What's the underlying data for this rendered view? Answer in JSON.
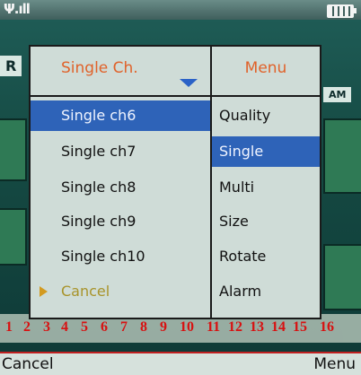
{
  "status": {
    "signal_icon": "signal-strength-icon",
    "battery_icon": "battery-icon"
  },
  "dialog": {
    "left_header": "Single Ch.",
    "right_header": "Menu",
    "channels": [
      {
        "label": "Single ch6",
        "selected": true
      },
      {
        "label": "Single ch7",
        "selected": false
      },
      {
        "label": "Single ch8",
        "selected": false
      },
      {
        "label": "Single ch9",
        "selected": false
      },
      {
        "label": "Single ch10",
        "selected": false
      },
      {
        "label": "Cancel",
        "selected": false
      }
    ],
    "menu": [
      {
        "label": "Quality",
        "selected": false
      },
      {
        "label": "Single",
        "selected": true
      },
      {
        "label": "Multi",
        "selected": false
      },
      {
        "label": "Size",
        "selected": false
      },
      {
        "label": "Rotate",
        "selected": false
      },
      {
        "label": "Alarm",
        "selected": false
      }
    ]
  },
  "background": {
    "channel_numbers": [
      "1",
      "2",
      "3",
      "4",
      "5",
      "6",
      "7",
      "8",
      "9",
      "10",
      "11",
      "12",
      "13",
      "14",
      "15",
      "16"
    ]
  },
  "softkeys": {
    "left": "Cancel",
    "right": "Menu"
  },
  "colors": {
    "selection": "#2e63b8",
    "header_text": "#e0622a",
    "dialog_bg": "#cfdcd7"
  }
}
